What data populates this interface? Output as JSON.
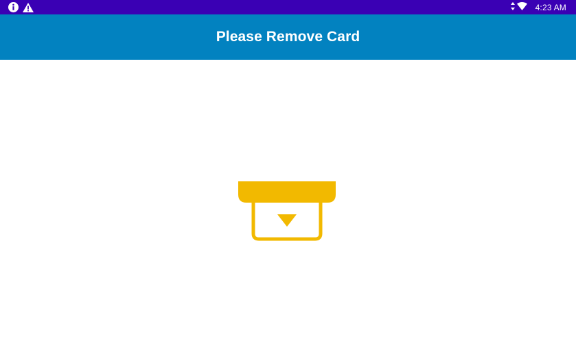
{
  "status_bar": {
    "time": "4:23 AM",
    "left_icons": [
      "info-icon",
      "warning-icon"
    ],
    "right_icons": [
      "data-arrows-icon",
      "wifi-icon"
    ],
    "background_color": "#3a00b4"
  },
  "app_bar": {
    "title": "Please Remove Card",
    "background_color": "#0282c0"
  },
  "main": {
    "icon": "remove-card-icon",
    "icon_color": "#f2b900"
  }
}
